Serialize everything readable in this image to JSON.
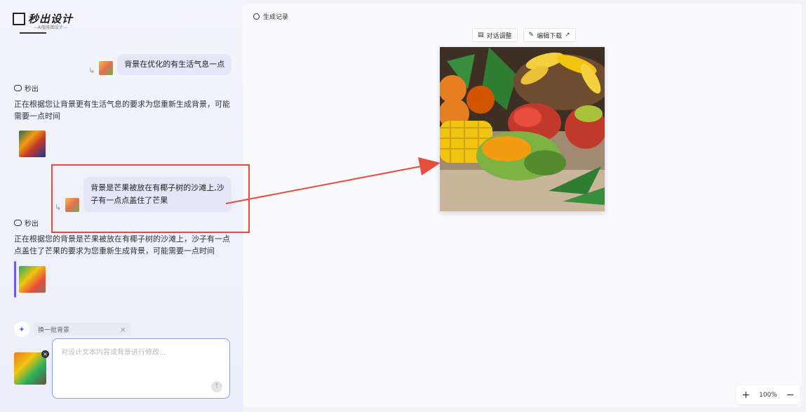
{
  "app": {
    "logo_text": "秒出设计",
    "logo_tagline": "—AI智能图设计—"
  },
  "chat": {
    "messages": [
      {
        "role": "user",
        "text": "背景在优化的有生活气息一点"
      },
      {
        "role": "bot",
        "name": "秒出",
        "text": "正在根据您让背景更有生活气息的要求为您重新生成背景，可能需要一点时间"
      },
      {
        "role": "user",
        "text": "背景是芒果被放在有椰子树的沙滩上,沙子有一点点盖住了芒果"
      },
      {
        "role": "bot",
        "name": "秒出",
        "text": "正在根据您的背景是芒果被放在有椰子树的沙滩上，沙子有一点点盖住了芒果的要求为您重新生成背景，可能需要一点时间"
      }
    ]
  },
  "suggestion": {
    "label": "换一批背景",
    "close": "×"
  },
  "input": {
    "placeholder": "对设计文本内容或背景进行修改...",
    "value": ""
  },
  "right_panel": {
    "history_label": "生成记录",
    "toolbar": {
      "dialog_adjust": "对话调整",
      "edit_download": "编辑下载"
    }
  },
  "zoom": {
    "plus": "+",
    "level": "100%",
    "minus": "−"
  },
  "icons": {
    "reply": "↳",
    "send": "↑",
    "external": "↗"
  },
  "colors": {
    "accent": "#6c5ce7",
    "user_bubble": "#e5e7f8",
    "highlight": "#e74c3c"
  }
}
